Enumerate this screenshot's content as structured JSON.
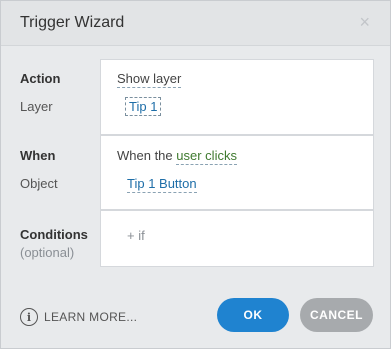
{
  "dialog": {
    "title": "Trigger Wizard",
    "close_label": "×"
  },
  "action_section": {
    "action_label": "Action",
    "layer_label": "Layer",
    "action_value": "Show layer",
    "layer_value": "Tip 1"
  },
  "when_section": {
    "when_label": "When",
    "object_label": "Object",
    "when_prefix": "When the",
    "when_value": "user clicks",
    "object_value": "Tip 1 Button"
  },
  "conditions_section": {
    "conditions_label": "Conditions",
    "optional_label": "(optional)",
    "add_if": "+ if"
  },
  "footer": {
    "info_glyph": "i",
    "learn_more": "LEARN MORE...",
    "ok_label": "OK",
    "cancel_label": "CANCEL"
  },
  "colors": {
    "accent": "#1f83d0",
    "cancel": "#a7aaad",
    "link_blue": "#1e6ea8",
    "link_green": "#3f7a2f"
  }
}
